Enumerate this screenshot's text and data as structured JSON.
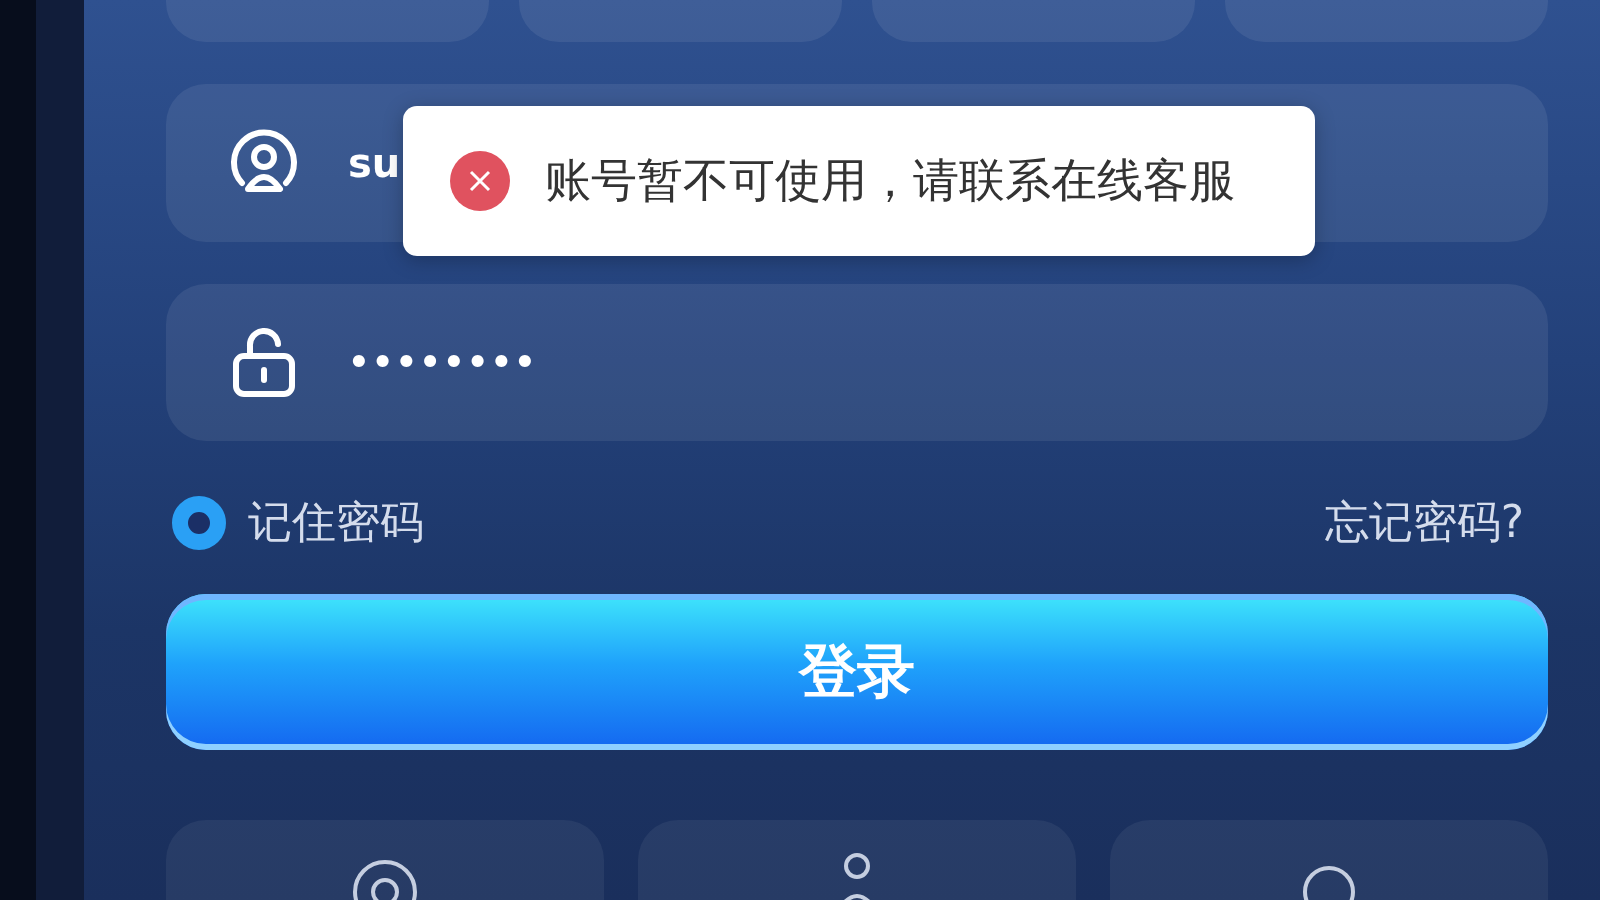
{
  "username_field": {
    "value": "su"
  },
  "toast": {
    "message": "账号暂不可使用，请联系在线客服"
  },
  "password_field": {
    "value": "••••••••"
  },
  "remember": {
    "label": "记住密码",
    "checked": true
  },
  "forgot_link": "忘记密码?",
  "login_button": "登录"
}
